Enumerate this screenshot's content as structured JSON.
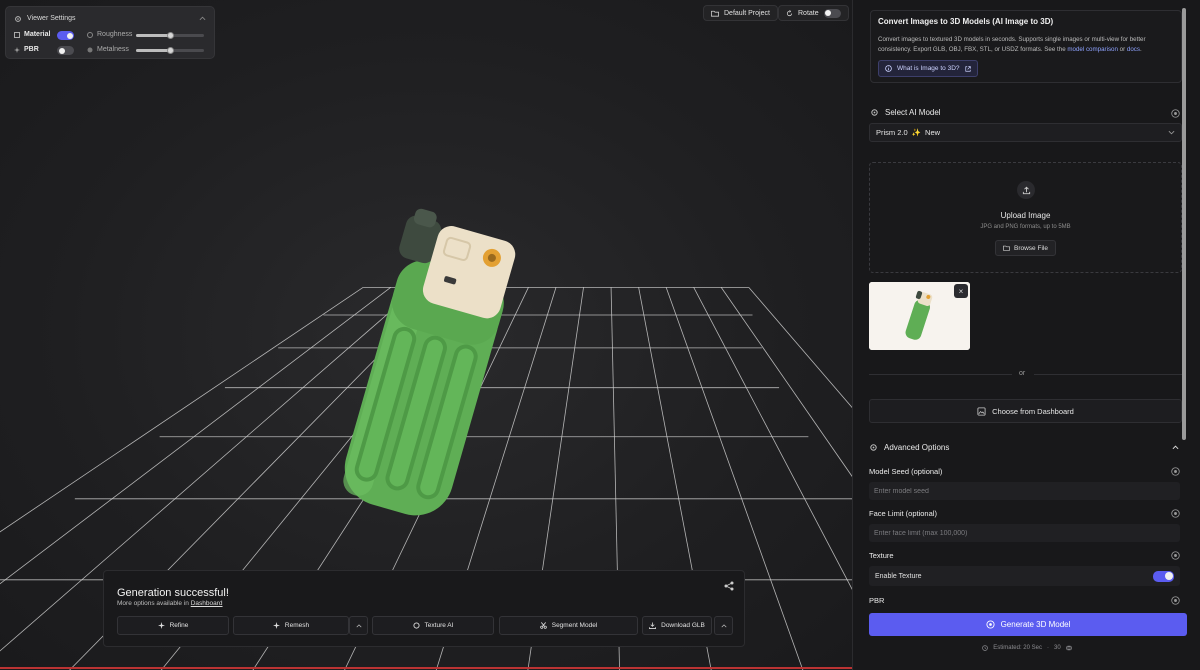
{
  "viewer_settings": {
    "title": "Viewer Settings",
    "material_label": "Material",
    "material_on": true,
    "pbr_label": "PBR",
    "pbr_on": false,
    "roughness_label": "Roughness",
    "roughness_value": 0.5,
    "metalness_label": "Metalness",
    "metalness_value": 0.5
  },
  "top_bar": {
    "project_label": "Default Project",
    "rotate_label": "Rotate",
    "rotate_on": false
  },
  "generation": {
    "title": "Generation successful!",
    "subtitle": "More options available in",
    "subtitle_link": "Dashboard",
    "actions": {
      "refine": "Refine",
      "remesh": "Remesh",
      "texture_ai": "Texture AI",
      "segment": "Segment Model",
      "download": "Download GLB"
    }
  },
  "info": {
    "title": "Convert Images to 3D Models (AI Image to 3D)",
    "desc_1": "Convert images to textured 3D models in seconds. Supports single images or multi-view for better consistency. Export GLB, OBJ, FBX, STL, or USDZ formats. See the",
    "desc_link_1": "model comparison",
    "desc_or": "or",
    "desc_link_2": "docs",
    "desc_end": ".",
    "what_button": "What is Image to 3D?"
  },
  "model_select": {
    "heading": "Select AI Model",
    "selected_model": "Prism 2.0",
    "sparkle": "✨",
    "badge": "New"
  },
  "upload": {
    "title": "Upload Image",
    "subtitle": "JPG and PNG formats, up to 5MB",
    "browse_label": "Browse File",
    "remove_label": "×",
    "or_text": "or",
    "dashboard_button": "Choose from Dashboard"
  },
  "advanced": {
    "heading": "Advanced Options",
    "seed_label": "Model Seed (optional)",
    "seed_placeholder": "Enter model seed",
    "seed_value": "",
    "face_label": "Face Limit (optional)",
    "face_placeholder": "Enter face limit (max 100,000)",
    "face_value": "",
    "texture_label": "Texture",
    "enable_texture_label": "Enable Texture",
    "texture_on": true,
    "pbr_label": "PBR"
  },
  "generate": {
    "button_label": "Generate 3D Model",
    "estimate_text": "Estimated: 20 Sec",
    "separator": "·",
    "credits": "30"
  },
  "colors": {
    "accent": "#5b5cf0",
    "lighter_green": "#5fae55",
    "lighter_cap": "#ece0c8"
  }
}
